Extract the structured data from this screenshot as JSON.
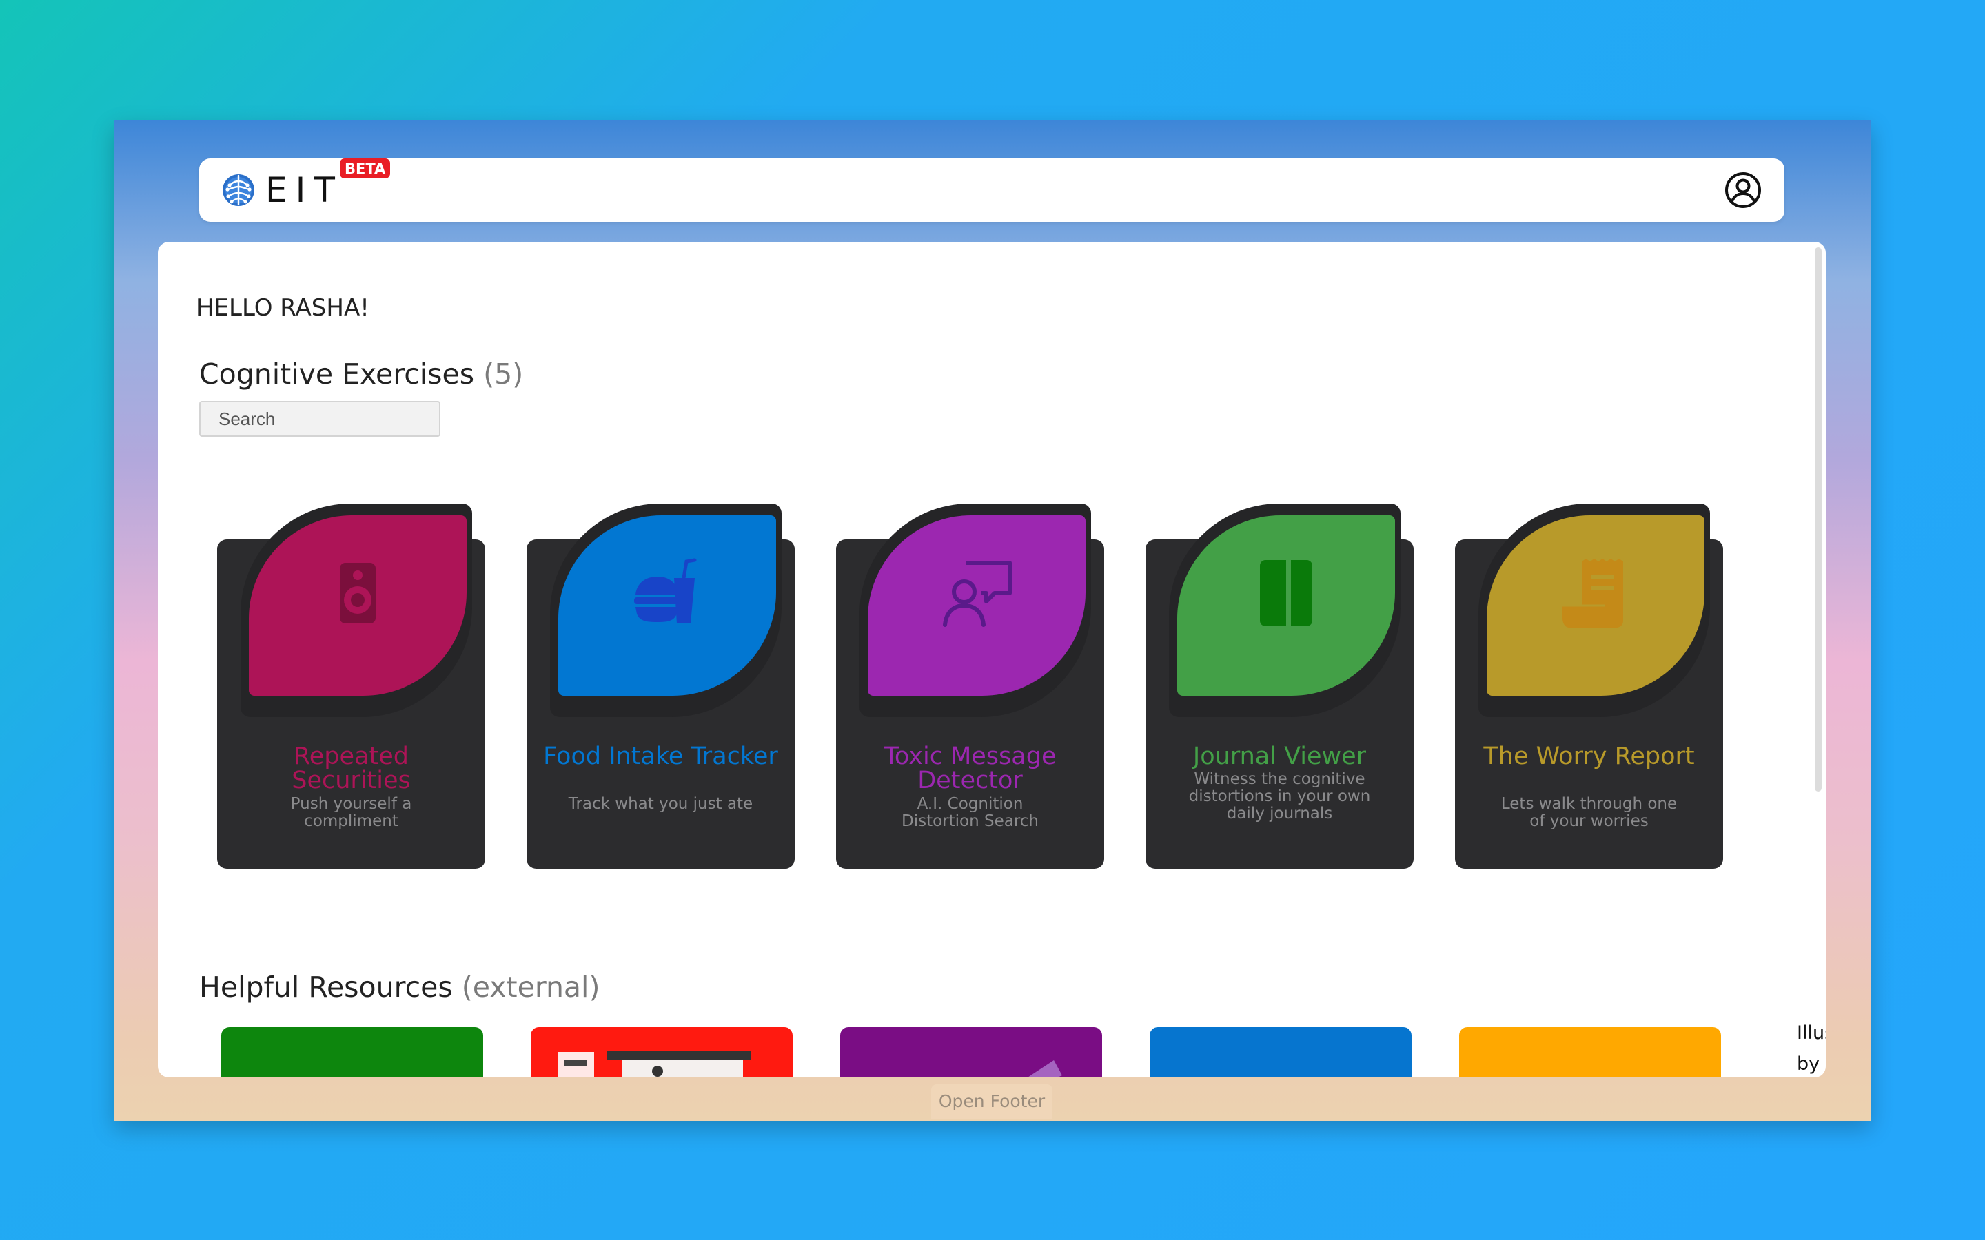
{
  "header": {
    "logo_text": "EIT",
    "beta_label": "BETA"
  },
  "main": {
    "greeting": "HELLO RASHA!",
    "exercises_title": "Cognitive Exercises",
    "exercises_count": "(5)",
    "search_placeholder": "Search",
    "resources_title": "Helpful Resources",
    "resources_suffix": "(external)",
    "resources_caption_line1": "Illus",
    "resources_caption_line2": "by F"
  },
  "exercises": [
    {
      "title": "Repeated Securities",
      "description": "Push yourself a compliment",
      "color": "#ad1457",
      "icon_color": "#7b0f3c",
      "icon": "speaker-icon"
    },
    {
      "title": "Food Intake Tracker",
      "description": "Track what you just ate",
      "color": "#0277d2",
      "icon_color": "#1844c8",
      "icon": "fast-food-icon"
    },
    {
      "title": "Toxic Message Detector",
      "description": "A.I. Cognition Distortion Search",
      "color": "#9c27b0",
      "icon_color": "#5a1a8a",
      "icon": "person-message-icon"
    },
    {
      "title": "Journal Viewer",
      "description": "Witness the cognitive distortions in your own daily journals",
      "color": "#43a047",
      "icon_color": "#0a7a0a",
      "icon": "book-icon"
    },
    {
      "title": "The Worry Report",
      "description": "Lets walk through one of your worries",
      "color": "#b89a2a",
      "icon_color": "#c48a18",
      "icon": "receipt-scroll-icon"
    }
  ],
  "resources": [
    {
      "color": "#0d860d"
    },
    {
      "color": "#ff1a10"
    },
    {
      "color": "#7a0d84"
    },
    {
      "color": "#0675cf"
    },
    {
      "color": "#ffa800"
    }
  ],
  "footer": {
    "open_label": "Open Footer"
  }
}
